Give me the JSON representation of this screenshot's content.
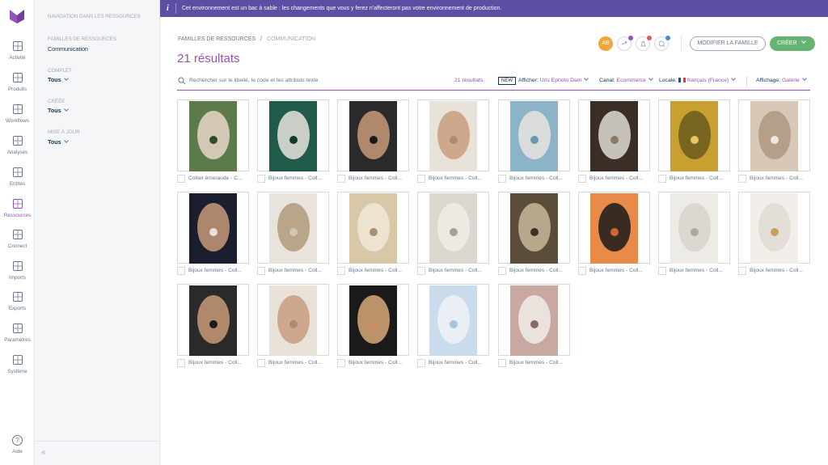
{
  "banner": {
    "text": "Cet environnement est un bac à sable : les changements que vous y ferez n'affecteront pas votre environnement de production."
  },
  "nav": [
    {
      "label": "Activité",
      "icon": "activity-icon"
    },
    {
      "label": "Produits",
      "icon": "products-icon"
    },
    {
      "label": "Workflows",
      "icon": "workflows-icon"
    },
    {
      "label": "Analyses",
      "icon": "analyses-icon"
    },
    {
      "label": "Entités",
      "icon": "entities-icon"
    },
    {
      "label": "Ressources",
      "icon": "resources-icon"
    },
    {
      "label": "Connect",
      "icon": "connect-icon"
    },
    {
      "label": "Imports",
      "icon": "imports-icon"
    },
    {
      "label": "Exports",
      "icon": "exports-icon"
    },
    {
      "label": "Paramètres",
      "icon": "settings-icon"
    },
    {
      "label": "Système",
      "icon": "system-icon"
    }
  ],
  "help": {
    "label": "Aide",
    "glyph": "?"
  },
  "filters": {
    "section_title": "NAVIGATION DANS LES RESSOURCES",
    "families_title": "FAMILLES DE RESSOURCES",
    "families_value": "Communication",
    "complete_title": "COMPLET",
    "complete_value": "Tous",
    "created_title": "CRÉÉE",
    "created_value": "Tous",
    "updated_title": "MISE À JOUR",
    "updated_value": "Tous",
    "collapse_glyph": "«"
  },
  "header": {
    "breadcrumb_root": "FAMILLES DE RESSOURCES",
    "breadcrumb_sep": "/",
    "breadcrumb_current": "COMMUNICATION",
    "title": "21 résultats",
    "avatar": "AB",
    "modify_button": "MODIFIER LA FAMILLE",
    "create_button": "CRÉER"
  },
  "toolbar": {
    "search_placeholder": "Rechercher sur le libellé, le code et les attributs texte",
    "result_count": "21 résultats.",
    "new_badge": "NEW",
    "display_label": "Afficher:",
    "display_value": "Urls Ephoto Dam",
    "channel_label": "Canal:",
    "channel_value": "Ecommerce",
    "locale_label": "Locale:",
    "locale_value": "français (France)",
    "view_label": "Affichage:",
    "view_value": "Galerie"
  },
  "assets": [
    {
      "caption": "Collier émeraude - C...",
      "palette": [
        "#5d7a4a",
        "#e8d6c8",
        "#2e4a2a"
      ]
    },
    {
      "caption": "Bijoux femmes - Coll...",
      "palette": [
        "#1f5a4a",
        "#e8e4dc",
        "#0f3a30"
      ]
    },
    {
      "caption": "Bijoux femmes - Coll...",
      "palette": [
        "#2a2a2a",
        "#c89a78",
        "#1a1a1a"
      ]
    },
    {
      "caption": "Bijoux femmes - Coll...",
      "palette": [
        "#e8e2d8",
        "#c89e80",
        "#b08a6c"
      ]
    },
    {
      "caption": "Bijoux femmes - Coll...",
      "palette": [
        "#8bb4c8",
        "#e8e4de",
        "#6a98b0"
      ]
    },
    {
      "caption": "Bijoux femmes - Coll...",
      "palette": [
        "#3a2e26",
        "#e0dcd4",
        "#8a7a66"
      ]
    },
    {
      "caption": "Bijoux femmes - Coll...",
      "palette": [
        "#c8a030",
        "#6a5a20",
        "#e8c860"
      ]
    },
    {
      "caption": "Bijoux femmes - Coll...",
      "palette": [
        "#d8c8b8",
        "#b09880",
        "#efe6dc"
      ]
    },
    {
      "caption": "Bijoux femmes - Coll...",
      "palette": [
        "#1a1e2e",
        "#c89a78",
        "#e8e0d8"
      ]
    },
    {
      "caption": "Bijoux femmes - Coll...",
      "palette": [
        "#e8e4dc",
        "#b09a7a",
        "#cfc6b8"
      ]
    },
    {
      "caption": "Bijoux femmes - Coll...",
      "palette": [
        "#d8c8a8",
        "#f0e8d8",
        "#a89070"
      ]
    },
    {
      "caption": "Bijoux femmes - Coll...",
      "palette": [
        "#dcd8d0",
        "#f0ece6",
        "#a8a098"
      ]
    },
    {
      "caption": "Bijoux femmes - Coll...",
      "palette": [
        "#5a4e3a",
        "#c8b89a",
        "#3a3224"
      ]
    },
    {
      "caption": "Bijoux femmes - Coll...",
      "palette": [
        "#e88a4a",
        "#1a1a1a",
        "#c86a30"
      ]
    },
    {
      "caption": "Bijoux femmes - Coll...",
      "palette": [
        "#ecebe6",
        "#d8d4cc",
        "#b0a898"
      ]
    },
    {
      "caption": "Bijoux femmes - Coll...",
      "palette": [
        "#f2efea",
        "#e0dcd4",
        "#c8a060"
      ]
    },
    {
      "caption": "Bijoux femmes - Coll...",
      "palette": [
        "#2a2a2a",
        "#c89a78",
        "#1a1a1a"
      ]
    },
    {
      "caption": "Bijoux femmes - Coll...",
      "palette": [
        "#e8e2d8",
        "#c89e80",
        "#b08a6c"
      ]
    },
    {
      "caption": "Bijoux femmes - Coll...",
      "palette": [
        "#1a1a1a",
        "#d8a878",
        "#c89060"
      ]
    },
    {
      "caption": "Bijoux femmes - Coll...",
      "palette": [
        "#c8dcec",
        "#eef2f6",
        "#a8c4dc"
      ]
    },
    {
      "caption": "Bijoux femmes - Coll...",
      "palette": [
        "#c8a8a0",
        "#f0ece8",
        "#8a6a60"
      ]
    }
  ],
  "colors": {
    "accent": "#9452ba",
    "banner": "#5a4fa3",
    "create": "#67b373",
    "avatar": "#f0a73a",
    "notif_dots": [
      "#9452ba",
      "#e05a5a",
      "#4a8ad0"
    ]
  }
}
